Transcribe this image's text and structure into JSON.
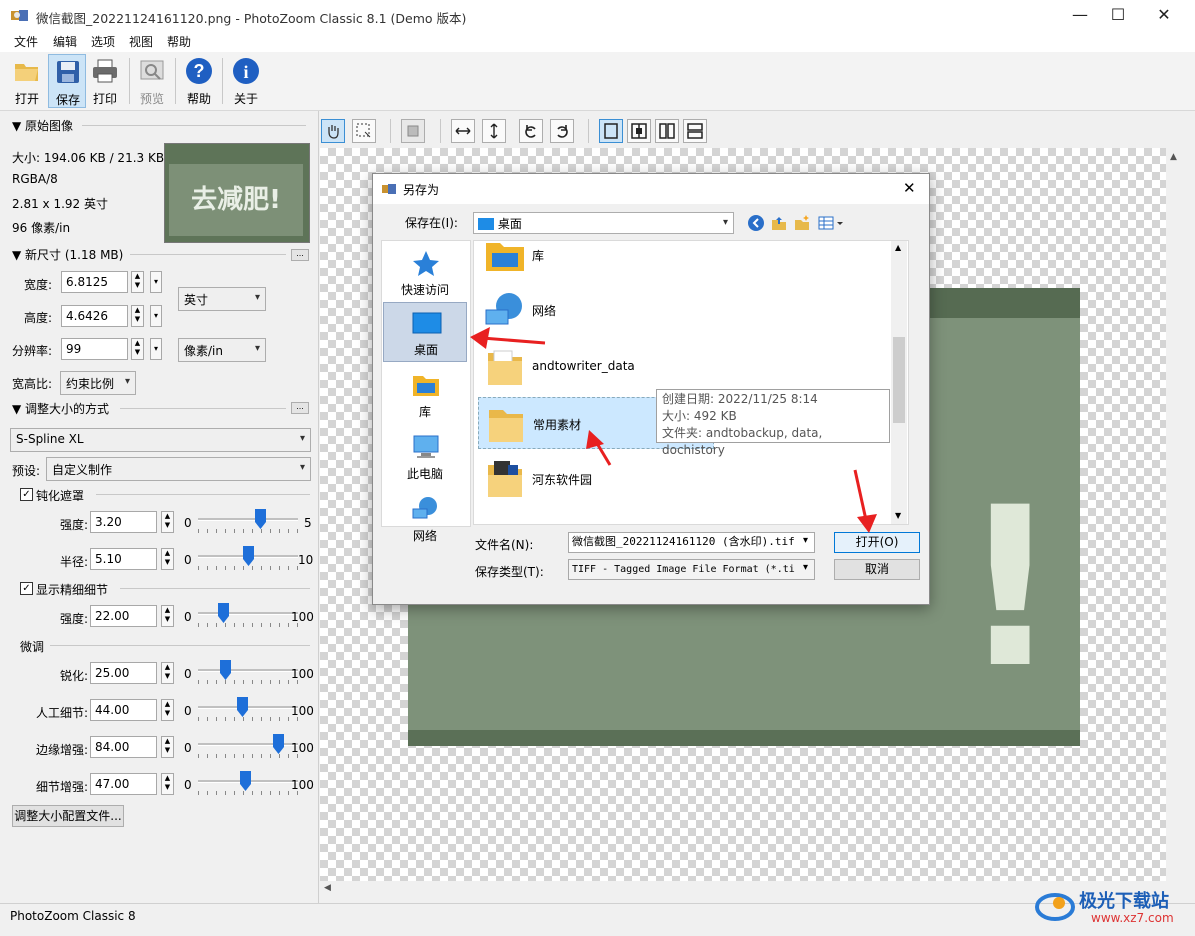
{
  "window": {
    "title": "微信截图_20221124161120.png - PhotoZoom Classic 8.1 (Demo 版本)"
  },
  "menu": [
    "文件",
    "编辑",
    "选项",
    "视图",
    "帮助"
  ],
  "toolbar": {
    "open": "打开",
    "save": "保存",
    "print": "打印",
    "preview": "预览",
    "help": "帮助",
    "about": "关于"
  },
  "original": {
    "header": "▼ 原始图像",
    "size": "大小: 194.06 KB / 21.3 KB",
    "mode": "RGBA/8",
    "dims": "2.81 x 1.92 英寸",
    "res": "96 像素/in",
    "thumb_text": "去减肥!"
  },
  "newsize": {
    "header": "▼ 新尺寸 (1.18 MB)",
    "more": "...",
    "width_label": "宽度:",
    "width_value": "6.8125",
    "height_label": "高度:",
    "height_value": "4.6426",
    "res_label": "分辨率:",
    "res_value": "99",
    "unit": "英寸",
    "res_unit": "像素/in",
    "aspect_label": "宽高比:",
    "aspect_value": "约束比例"
  },
  "resize": {
    "header": "▼ 调整大小的方式",
    "more": "...",
    "method": "S-Spline XL",
    "preset_label": "预设:",
    "preset_value": "自定义制作",
    "unsharp_label": "钝化遮罩",
    "strength_label": "强度:",
    "strength_value": "3.20",
    "strength_min": "0",
    "strength_max": "5",
    "strength_level": 0.64,
    "radius_label": "半径:",
    "radius_value": "5.10",
    "radius_min": "0",
    "radius_max": "10",
    "radius_level": 0.51,
    "detail_label": "显示精细细节",
    "detail_strength_label": "强度:",
    "detail_strength_value": "22.00",
    "detail_min": "0",
    "detail_max": "100",
    "detail_level": 0.22,
    "fine_header": "微调",
    "sharp_label": "锐化:",
    "sharp_value": "25.00",
    "sharp_level": 0.25,
    "artificial_label": "人工细节:",
    "artificial_value": "44.00",
    "artificial_level": 0.44,
    "edge_label": "边缘增强:",
    "edge_value": "84.00",
    "edge_level": 0.84,
    "detailenh_label": "细节增强:",
    "detailenh_value": "47.00",
    "detailenh_level": 0.47,
    "min": "0",
    "max": "100",
    "profile_button": "调整大小配置文件..."
  },
  "status": {
    "text": "PhotoZoom Classic 8"
  },
  "dialog": {
    "title": "另存为",
    "savein_label": "保存在(I):",
    "savein_value": "桌面",
    "places": [
      "快速访问",
      "桌面",
      "库",
      "此电脑",
      "网络"
    ],
    "files": [
      "库",
      "网络",
      "andtowriter_data",
      "常用素材",
      "河东软件园"
    ],
    "tooltip": {
      "created": "创建日期: 2022/11/25 8:14",
      "size": "大小: 492 KB",
      "folders": "文件夹: andtobackup, data, dochistory"
    },
    "filename_label": "文件名(N):",
    "filename_value": "微信截图_20221124161120 (含水印).tif",
    "filetype_label": "保存类型(T):",
    "filetype_value": "TIFF - Tagged Image File Format (*.ti",
    "open_button": "打开(O)",
    "cancel_button": "取消"
  },
  "canvas": {
    "preview_text": "!"
  },
  "watermark": {
    "site": "极光下载站",
    "url": "www.xz7.com"
  },
  "colors": {
    "accent": "#1e6fd9",
    "selection": "#cce8ff",
    "arrow": "#e82020",
    "image_green": "#7a8f74"
  }
}
